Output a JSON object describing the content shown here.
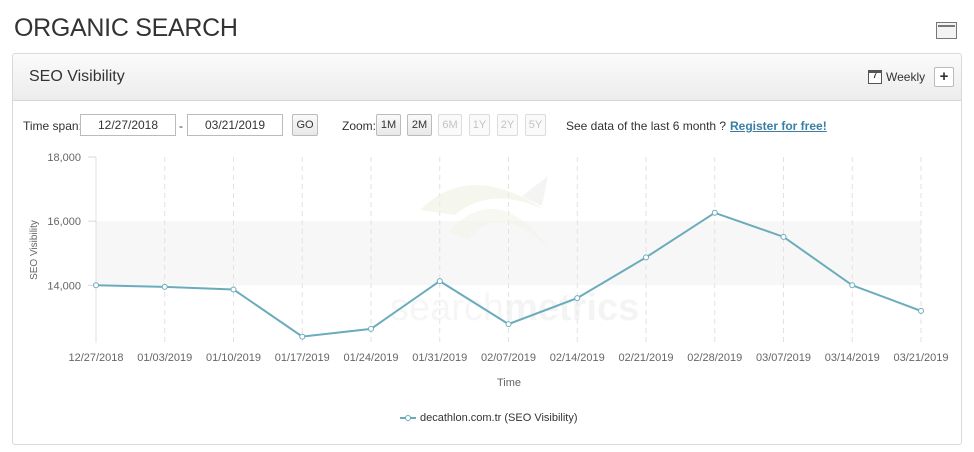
{
  "page_title": "ORGANIC SEARCH",
  "panel": {
    "title": "SEO Visibility",
    "interval_label": "Weekly",
    "interval_icon": "calendar-icon",
    "add_label": "+"
  },
  "controls": {
    "time_span_label": "Time span:",
    "start_date": "12/27/2018",
    "separator": "-",
    "end_date": "03/21/2019",
    "go_label": "GO",
    "zoom_label": "Zoom:",
    "zoom_options": [
      {
        "label": "1M",
        "enabled": true
      },
      {
        "label": "2M",
        "enabled": true
      },
      {
        "label": "6M",
        "enabled": false
      },
      {
        "label": "1Y",
        "enabled": false
      },
      {
        "label": "2Y",
        "enabled": false
      },
      {
        "label": "5Y",
        "enabled": false
      }
    ],
    "promo_text": "See data of the last 6 month ?",
    "register_link": "Register for free!"
  },
  "watermark": {
    "part1": "search",
    "part2": "metrics"
  },
  "chart_data": {
    "type": "line",
    "categories": [
      "12/27/2018",
      "01/03/2019",
      "01/10/2019",
      "01/17/2019",
      "01/24/2019",
      "01/31/2019",
      "02/07/2019",
      "02/14/2019",
      "02/21/2019",
      "02/28/2019",
      "03/07/2019",
      "03/14/2019",
      "03/21/2019"
    ],
    "series": [
      {
        "name": "decathlon.com.tr (SEO Visibility)",
        "color": "#6aacbc",
        "values": [
          14000,
          13950,
          13870,
          12400,
          12640,
          14130,
          12790,
          13600,
          14870,
          16260,
          15510,
          14000,
          13200
        ]
      }
    ],
    "xlabel": "Time",
    "ylabel": "SEO Visibility",
    "yticks": [
      "18,000",
      "16,000",
      "14,000"
    ],
    "ytick_values": [
      18000,
      16000,
      14000
    ],
    "ylim": [
      12200,
      18000
    ],
    "band": [
      14000,
      16000
    ],
    "grid": "vertical-dashed",
    "legend_position": "bottom-center"
  }
}
